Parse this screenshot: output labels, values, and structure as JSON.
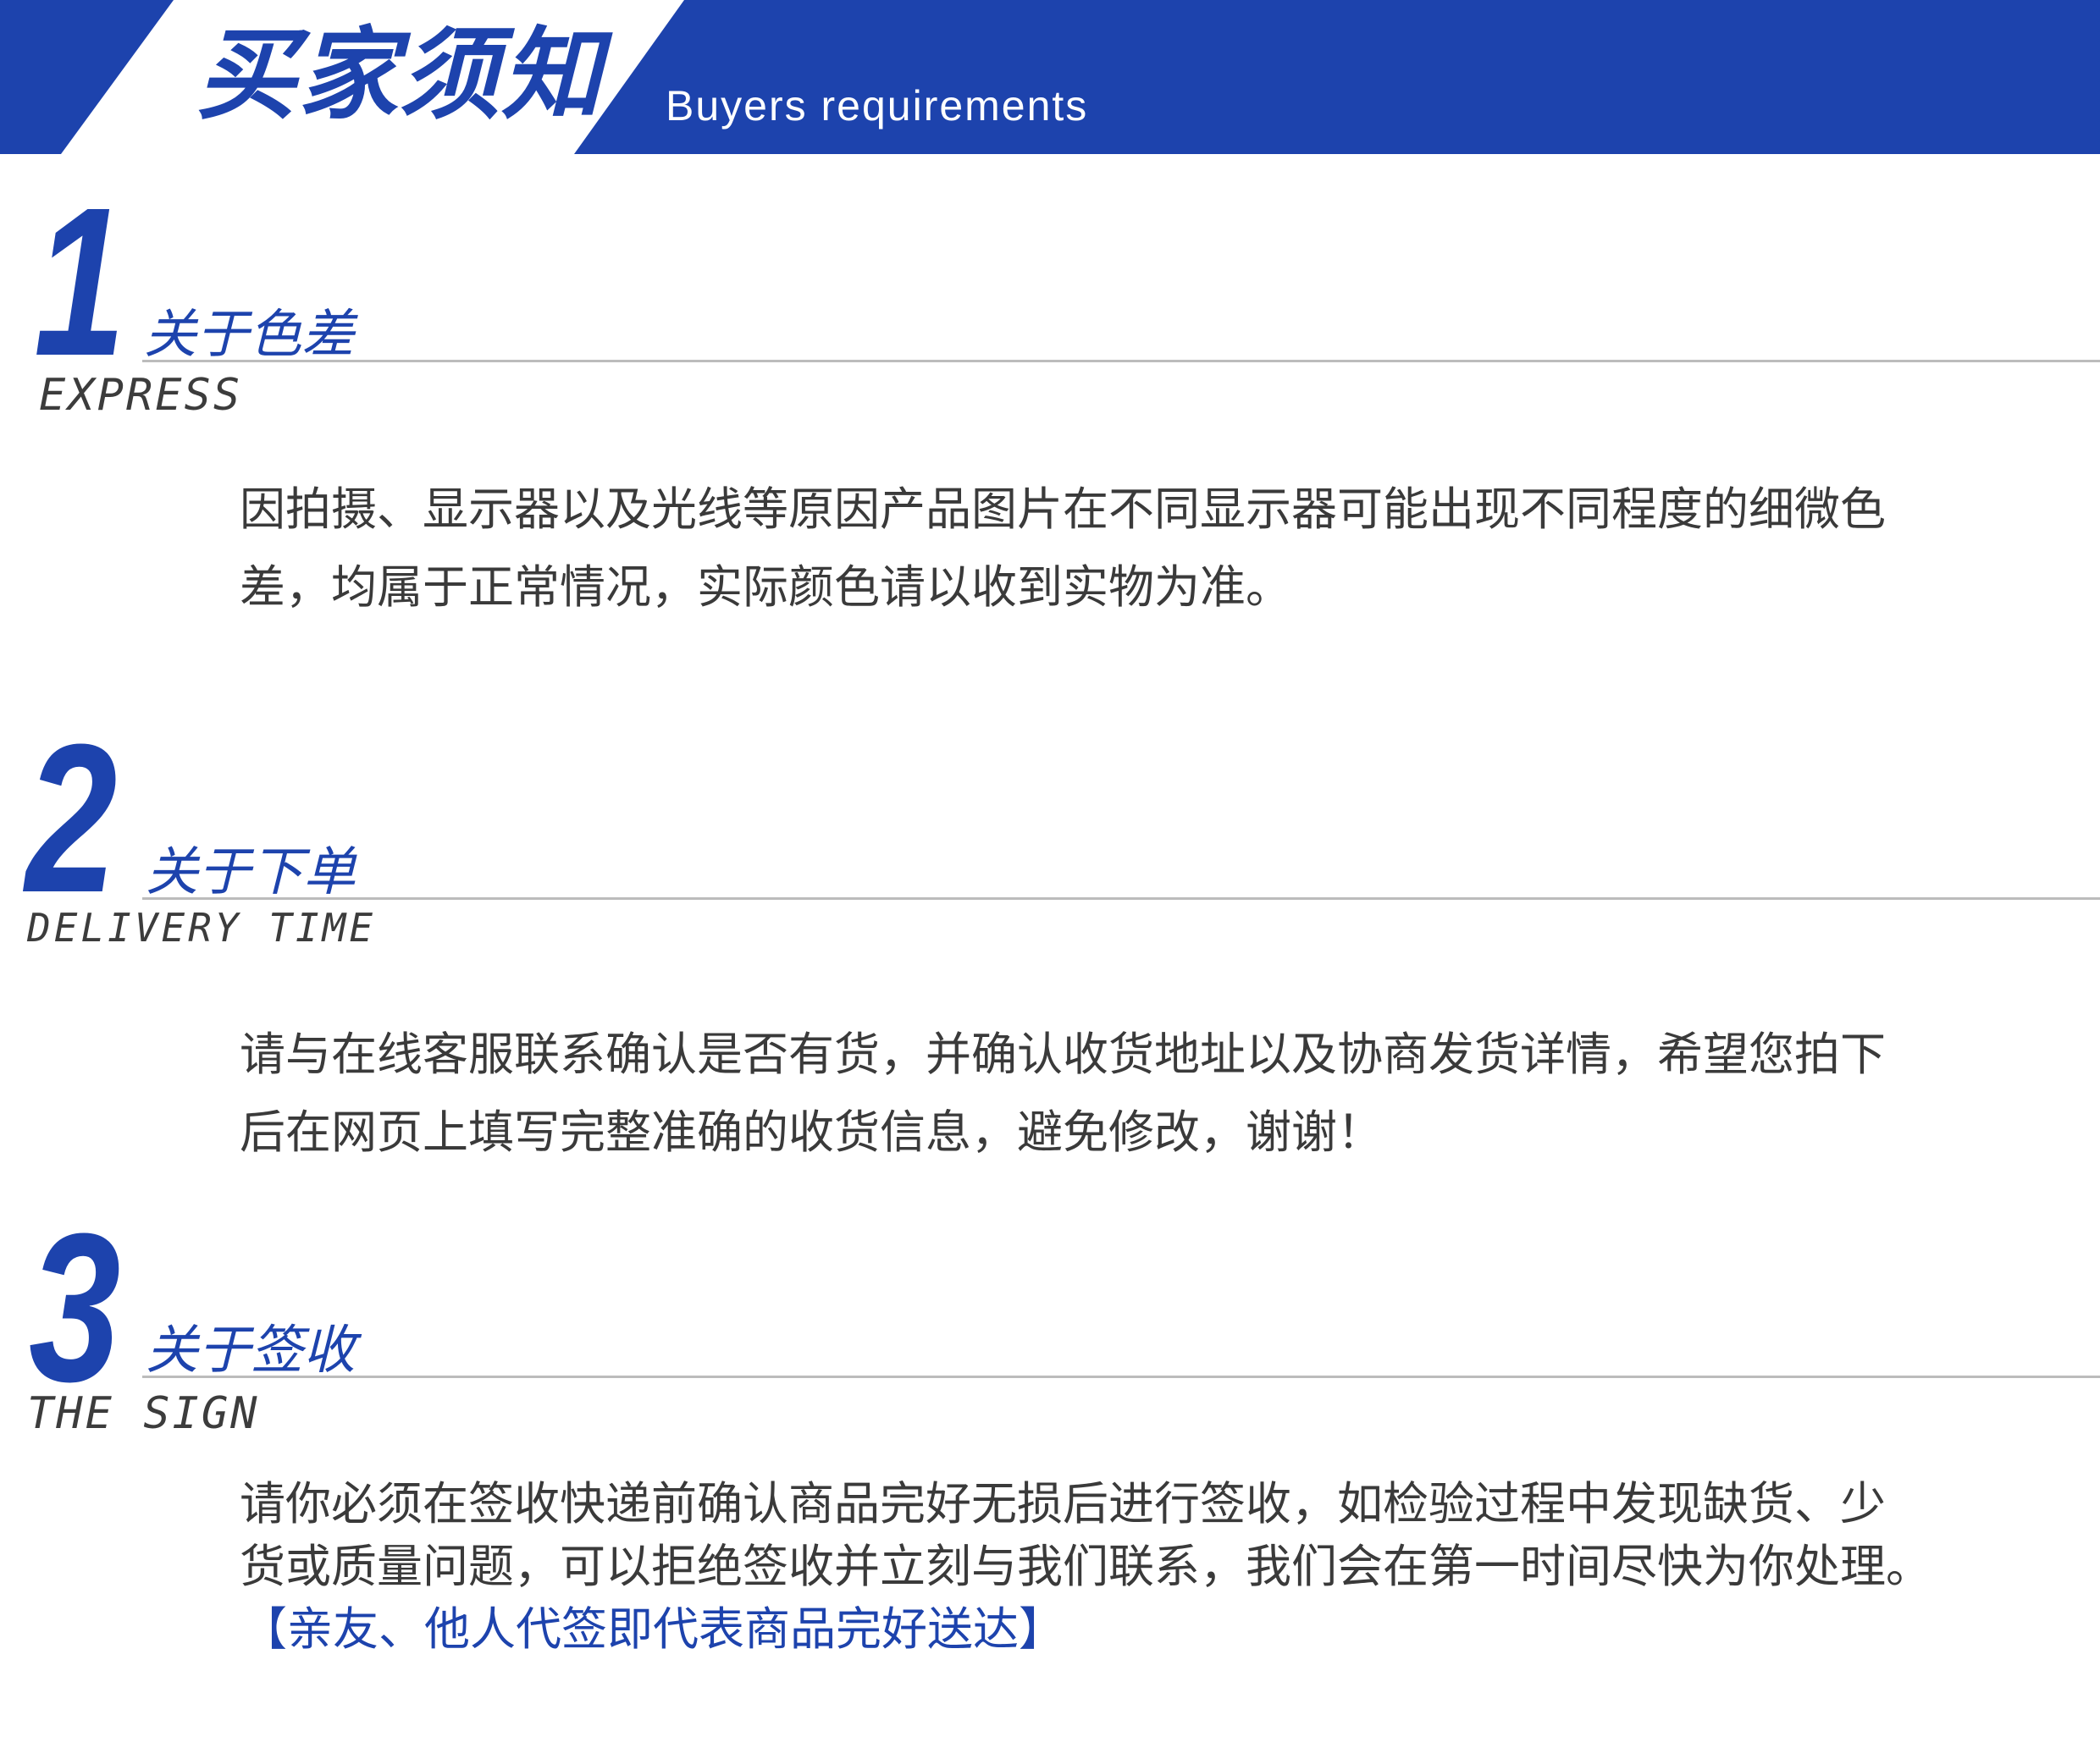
{
  "header": {
    "title": "买家须知",
    "subtitle": "Buyers requirements",
    "banner_color": "#1d43ad"
  },
  "sections": [
    {
      "number": "1",
      "heading": "关于色差",
      "label_en": "EXPRESS",
      "lines": [
        "因拍摄、显示器以及光线等原因产品图片在不同显示器可能出现不同程度的细微色",
        "差，均属于正常情况，实际颜色请以收到实物为准。"
      ]
    },
    {
      "number": "2",
      "heading": "关于下单",
      "label_en": "DELIVERY TIME",
      "lines": [
        "请与在线客服联系确认是否有货，并确认收货地址以及协商发货详情，希望您拍下",
        "后在网页上填写完整准确的收货信息，避免修改，谢谢！"
      ]
    },
    {
      "number": "3",
      "heading": "关于签收",
      "label_en": "THE SIGN",
      "lines": [
        "请你必须在签收快递前确认商品完好无损后进行签收，如检验过程中发现缺货、少",
        "货或质量问题，可以拒绝签收并立刻与我们联系，我们会在第一时间尽快为你处理。"
      ],
      "highlight": "【亲友、他人代签即代表商品完好送达】"
    }
  ],
  "colors": {
    "accent": "#1d43ad",
    "body_text": "#3a3a3a",
    "rule": "#bcbcbc"
  }
}
